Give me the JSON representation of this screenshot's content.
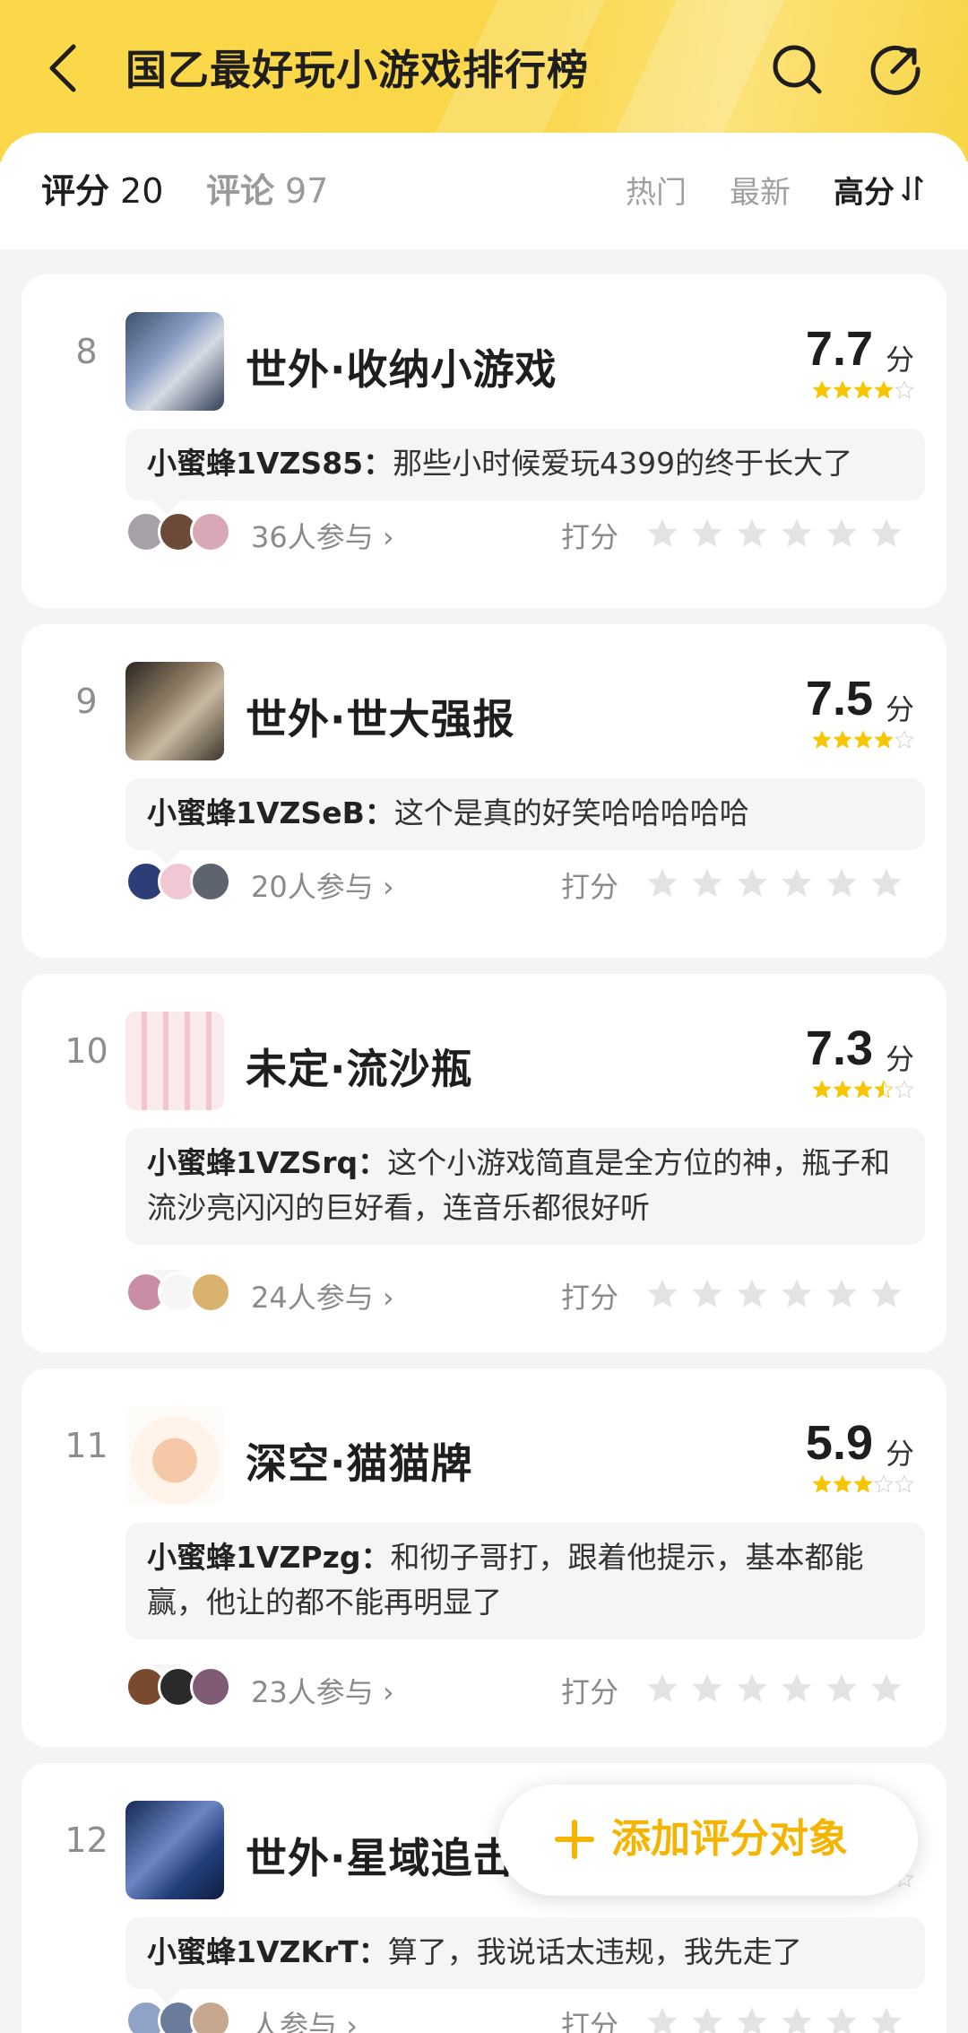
{
  "header": {
    "title": "国乙最好玩小游戏排行榜",
    "back_icon": "chevron-left-icon",
    "search_icon": "search-icon",
    "share_icon": "share-icon"
  },
  "tabs": {
    "rating_label": "评分",
    "rating_count": "20",
    "comment_label": "评论",
    "comment_count": "97",
    "sort_hot": "热门",
    "sort_new": "最新",
    "sort_high": "高分"
  },
  "rate_label": "打分",
  "score_unit": "分",
  "items": [
    {
      "rank": "8",
      "title": "世外·收纳小游戏",
      "score": "7.7",
      "stars": 4.0,
      "user": "小蜜蜂1VZS85：",
      "comment": "那些小时候爱玩4399的终于长大了",
      "participants": "36人参与"
    },
    {
      "rank": "9",
      "title": "世外·世大强报",
      "score": "7.5",
      "stars": 4.0,
      "user": "小蜜蜂1VZSeB：",
      "comment": "这个是真的好笑哈哈哈哈哈",
      "participants": "20人参与"
    },
    {
      "rank": "10",
      "title": "未定·流沙瓶",
      "score": "7.3",
      "stars": 3.5,
      "user": "小蜜蜂1VZSrq：",
      "comment": "这个小游戏简直是全方位的神，瓶子和流沙亮闪闪的巨好看，连音乐都很好听",
      "participants": "24人参与"
    },
    {
      "rank": "11",
      "title": "深空·猫猫牌",
      "score": "5.9",
      "stars": 3.0,
      "user": "小蜜蜂1VZPzg：",
      "comment": "和彻子哥打，跟着他提示，基本都能赢，他让的都不能再明显了",
      "participants": "23人参与"
    },
    {
      "rank": "12",
      "title": "世外·星域追击",
      "score": "",
      "stars": 0,
      "user": "小蜜蜂1VZKrT：",
      "comment": "算了，我说话太违规，我先走了",
      "participants": "人参与"
    }
  ],
  "fab": {
    "label": "添加评分对象",
    "icon": "plus-icon"
  },
  "colors": {
    "accent": "#fbd84a",
    "star": "#f7c600",
    "fab_text": "#f4b400"
  }
}
